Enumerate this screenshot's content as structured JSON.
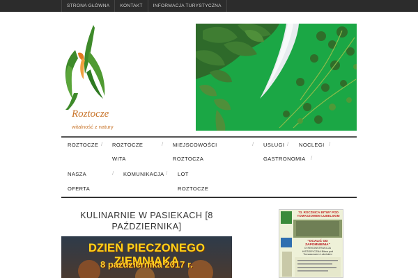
{
  "topnav": {
    "items": [
      {
        "label": "STRONA GŁÓWNA"
      },
      {
        "label": "KONTAKT"
      },
      {
        "label": "INFORMACJA TURYSTYCZNA"
      }
    ]
  },
  "logo": {
    "name": "Roztocze",
    "tagline": "witalność z natury"
  },
  "menu": {
    "items": [
      {
        "label": "ROZTOCZE"
      },
      {
        "label": "ROZTOCZE"
      },
      {
        "label": "WITA"
      },
      {
        "label": "MIEJSCOWOŚCI"
      },
      {
        "label": "ROZTOCZA"
      },
      {
        "label": "USŁUGI"
      },
      {
        "label": "NOCLEGI"
      },
      {
        "label": "GASTRONOMIA"
      },
      {
        "label": "NASZA"
      },
      {
        "label": "OFERTA"
      },
      {
        "label": "KOMUNIKACJA"
      },
      {
        "label": "LOT"
      },
      {
        "label": "ROZTOCZE"
      }
    ]
  },
  "post": {
    "title": "KULINARNIE W PASIEKACH [8 PAŹDZIERNIKA]",
    "image_line1": "DZIEŃ PIECZONEGO ZIEMNIAKA",
    "image_line2": "8 października 2017 r."
  },
  "poster": {
    "head": "73. ROCZNICA BITWY POD TOMASZOWEM LUBELSKIM",
    "mid": "\"OCALIĆ OD ZAPOMNIENIA\"",
    "mid2": "IX REKONSTRUKCJA HISTORYCZNA Bitwa pod Tomaszowem Lubelskim"
  },
  "colors": {
    "topbar": "#2c2c2c",
    "brand_orange": "#c8742a",
    "logo_green": "#3e8a2a",
    "menu_rule": "#333333"
  }
}
